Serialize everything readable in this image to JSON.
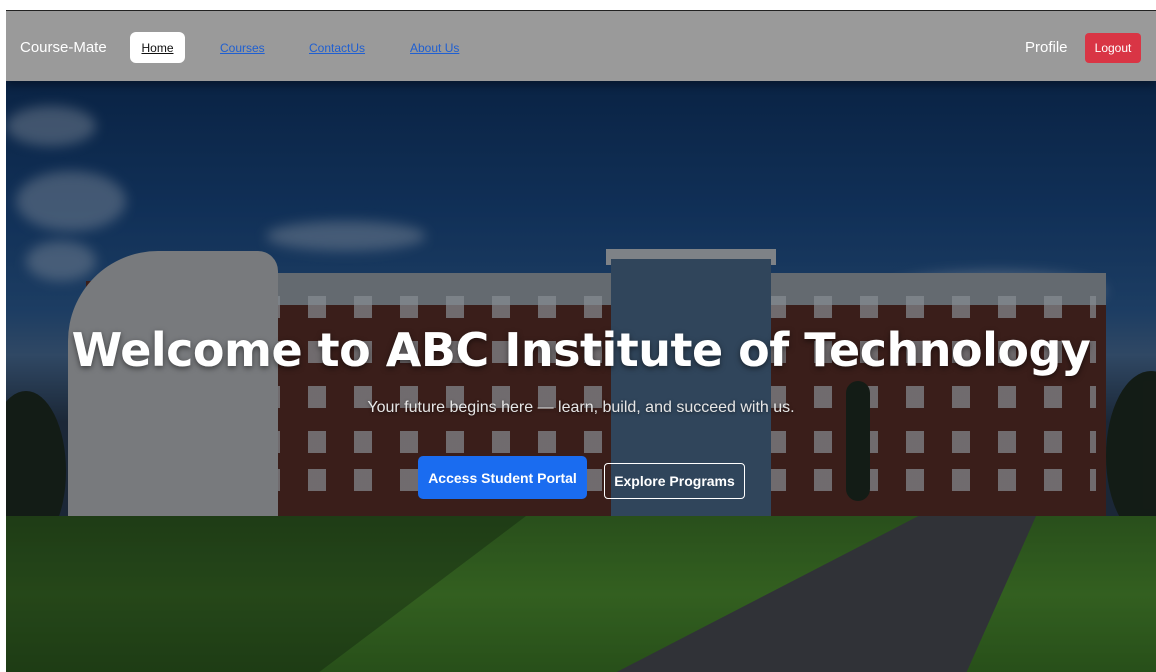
{
  "navbar": {
    "brand": "Course-Mate",
    "links": [
      "Home",
      "Courses",
      "ContactUs",
      "About Us"
    ],
    "profile": "Profile",
    "logout": "Logout"
  },
  "hero": {
    "title": "Welcome to ABC Institute of Technology",
    "subtitle": "Your future begins here — learn, build, and succeed with us.",
    "primary_button": "Access Student Portal",
    "secondary_button": "Explore Programs"
  },
  "colors": {
    "navbar": "#9a9a9a",
    "logout": "#d93545",
    "primary": "#1a6cf0",
    "link": "#1f5fd1"
  }
}
